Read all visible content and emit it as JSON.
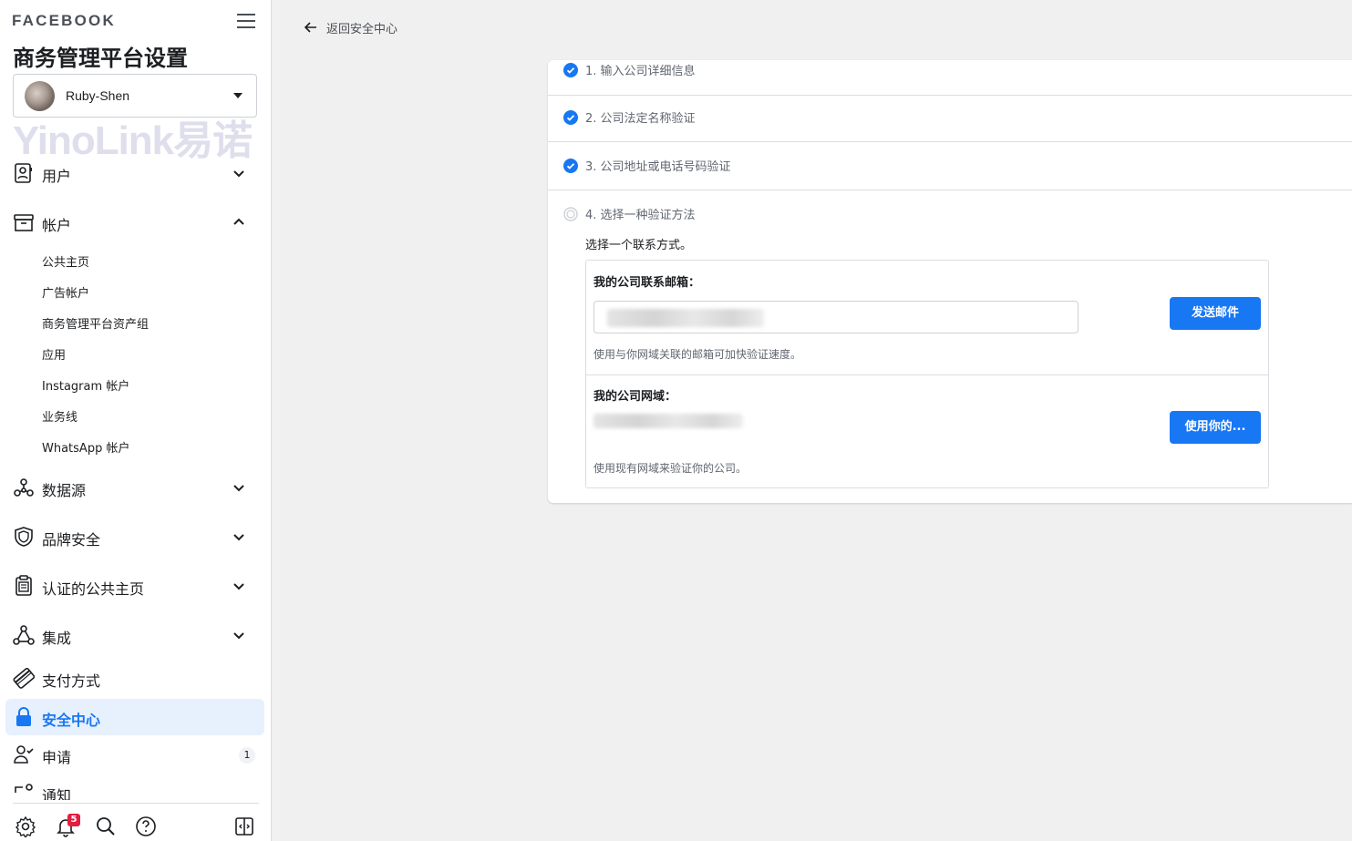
{
  "sidebar": {
    "brand": "FACEBOOK",
    "title": "商务管理平台设置",
    "account_name": "Ruby-Shen",
    "watermark": "YinoLink易诺",
    "items": [
      {
        "label": "用户",
        "icon": "users-icon"
      },
      {
        "label": "帐户",
        "icon": "account-box-icon"
      },
      {
        "label": "数据源",
        "icon": "data-source-icon"
      },
      {
        "label": "品牌安全",
        "icon": "shield-icon"
      },
      {
        "label": "认证的公共主页",
        "icon": "clipboard-icon"
      },
      {
        "label": "集成",
        "icon": "integration-icon"
      },
      {
        "label": "支付方式",
        "icon": "credit-card-icon"
      },
      {
        "label": "安全中心",
        "icon": "lock-icon"
      },
      {
        "label": "申请",
        "icon": "person-check-icon",
        "count": "1"
      },
      {
        "label": "通知",
        "icon": "notification-icon"
      }
    ],
    "sub_items": [
      "公共主页",
      "广告帐户",
      "商务管理平台资产组",
      "应用",
      "Instagram 帐户",
      "业务线",
      "WhatsApp 帐户"
    ],
    "footer": {
      "notification_count": "5"
    }
  },
  "main": {
    "back_label": "返回安全中心",
    "steps": [
      {
        "label": "1. 输入公司详细信息",
        "done": true
      },
      {
        "label": "2. 公司法定名称验证",
        "done": true
      },
      {
        "label": "3. 公司地址或电话号码验证",
        "done": true
      },
      {
        "label": "4. 选择一种验证方法",
        "done": false
      }
    ],
    "choose_prompt": "选择一个联系方式。",
    "email_option": {
      "title": "我的公司联系邮箱：",
      "button": "发送邮件",
      "help": "使用与你网域关联的邮箱可加快验证速度。"
    },
    "domain_option": {
      "title": "我的公司网域：",
      "button": "使用你的...",
      "help": "使用现有网域来验证你的公司。"
    }
  },
  "colors": {
    "accent": "#1877f2",
    "active_bg": "#e7f0fd",
    "badge": "#e41e3f"
  }
}
